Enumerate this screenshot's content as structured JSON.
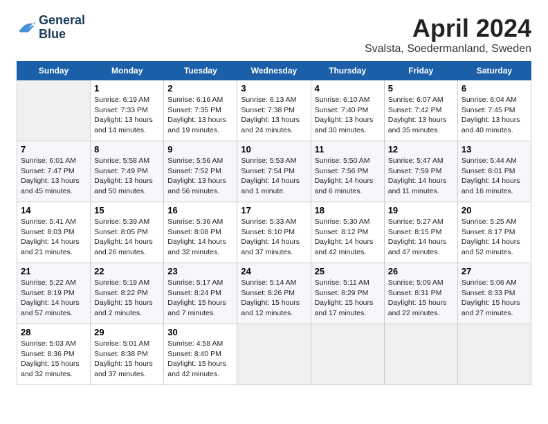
{
  "logo": {
    "line1": "General",
    "line2": "Blue"
  },
  "title": "April 2024",
  "location": "Svalsta, Soedermanland, Sweden",
  "headers": [
    "Sunday",
    "Monday",
    "Tuesday",
    "Wednesday",
    "Thursday",
    "Friday",
    "Saturday"
  ],
  "weeks": [
    [
      {
        "day": "",
        "info": ""
      },
      {
        "day": "1",
        "info": "Sunrise: 6:19 AM\nSunset: 7:33 PM\nDaylight: 13 hours\nand 14 minutes."
      },
      {
        "day": "2",
        "info": "Sunrise: 6:16 AM\nSunset: 7:35 PM\nDaylight: 13 hours\nand 19 minutes."
      },
      {
        "day": "3",
        "info": "Sunrise: 6:13 AM\nSunset: 7:38 PM\nDaylight: 13 hours\nand 24 minutes."
      },
      {
        "day": "4",
        "info": "Sunrise: 6:10 AM\nSunset: 7:40 PM\nDaylight: 13 hours\nand 30 minutes."
      },
      {
        "day": "5",
        "info": "Sunrise: 6:07 AM\nSunset: 7:42 PM\nDaylight: 13 hours\nand 35 minutes."
      },
      {
        "day": "6",
        "info": "Sunrise: 6:04 AM\nSunset: 7:45 PM\nDaylight: 13 hours\nand 40 minutes."
      }
    ],
    [
      {
        "day": "7",
        "info": "Sunrise: 6:01 AM\nSunset: 7:47 PM\nDaylight: 13 hours\nand 45 minutes."
      },
      {
        "day": "8",
        "info": "Sunrise: 5:58 AM\nSunset: 7:49 PM\nDaylight: 13 hours\nand 50 minutes."
      },
      {
        "day": "9",
        "info": "Sunrise: 5:56 AM\nSunset: 7:52 PM\nDaylight: 13 hours\nand 56 minutes."
      },
      {
        "day": "10",
        "info": "Sunrise: 5:53 AM\nSunset: 7:54 PM\nDaylight: 14 hours\nand 1 minute."
      },
      {
        "day": "11",
        "info": "Sunrise: 5:50 AM\nSunset: 7:56 PM\nDaylight: 14 hours\nand 6 minutes."
      },
      {
        "day": "12",
        "info": "Sunrise: 5:47 AM\nSunset: 7:59 PM\nDaylight: 14 hours\nand 11 minutes."
      },
      {
        "day": "13",
        "info": "Sunrise: 5:44 AM\nSunset: 8:01 PM\nDaylight: 14 hours\nand 16 minutes."
      }
    ],
    [
      {
        "day": "14",
        "info": "Sunrise: 5:41 AM\nSunset: 8:03 PM\nDaylight: 14 hours\nand 21 minutes."
      },
      {
        "day": "15",
        "info": "Sunrise: 5:39 AM\nSunset: 8:05 PM\nDaylight: 14 hours\nand 26 minutes."
      },
      {
        "day": "16",
        "info": "Sunrise: 5:36 AM\nSunset: 8:08 PM\nDaylight: 14 hours\nand 32 minutes."
      },
      {
        "day": "17",
        "info": "Sunrise: 5:33 AM\nSunset: 8:10 PM\nDaylight: 14 hours\nand 37 minutes."
      },
      {
        "day": "18",
        "info": "Sunrise: 5:30 AM\nSunset: 8:12 PM\nDaylight: 14 hours\nand 42 minutes."
      },
      {
        "day": "19",
        "info": "Sunrise: 5:27 AM\nSunset: 8:15 PM\nDaylight: 14 hours\nand 47 minutes."
      },
      {
        "day": "20",
        "info": "Sunrise: 5:25 AM\nSunset: 8:17 PM\nDaylight: 14 hours\nand 52 minutes."
      }
    ],
    [
      {
        "day": "21",
        "info": "Sunrise: 5:22 AM\nSunset: 8:19 PM\nDaylight: 14 hours\nand 57 minutes."
      },
      {
        "day": "22",
        "info": "Sunrise: 5:19 AM\nSunset: 8:22 PM\nDaylight: 15 hours\nand 2 minutes."
      },
      {
        "day": "23",
        "info": "Sunrise: 5:17 AM\nSunset: 8:24 PM\nDaylight: 15 hours\nand 7 minutes."
      },
      {
        "day": "24",
        "info": "Sunrise: 5:14 AM\nSunset: 8:26 PM\nDaylight: 15 hours\nand 12 minutes."
      },
      {
        "day": "25",
        "info": "Sunrise: 5:11 AM\nSunset: 8:29 PM\nDaylight: 15 hours\nand 17 minutes."
      },
      {
        "day": "26",
        "info": "Sunrise: 5:09 AM\nSunset: 8:31 PM\nDaylight: 15 hours\nand 22 minutes."
      },
      {
        "day": "27",
        "info": "Sunrise: 5:06 AM\nSunset: 8:33 PM\nDaylight: 15 hours\nand 27 minutes."
      }
    ],
    [
      {
        "day": "28",
        "info": "Sunrise: 5:03 AM\nSunset: 8:36 PM\nDaylight: 15 hours\nand 32 minutes."
      },
      {
        "day": "29",
        "info": "Sunrise: 5:01 AM\nSunset: 8:38 PM\nDaylight: 15 hours\nand 37 minutes."
      },
      {
        "day": "30",
        "info": "Sunrise: 4:58 AM\nSunset: 8:40 PM\nDaylight: 15 hours\nand 42 minutes."
      },
      {
        "day": "",
        "info": ""
      },
      {
        "day": "",
        "info": ""
      },
      {
        "day": "",
        "info": ""
      },
      {
        "day": "",
        "info": ""
      }
    ]
  ]
}
